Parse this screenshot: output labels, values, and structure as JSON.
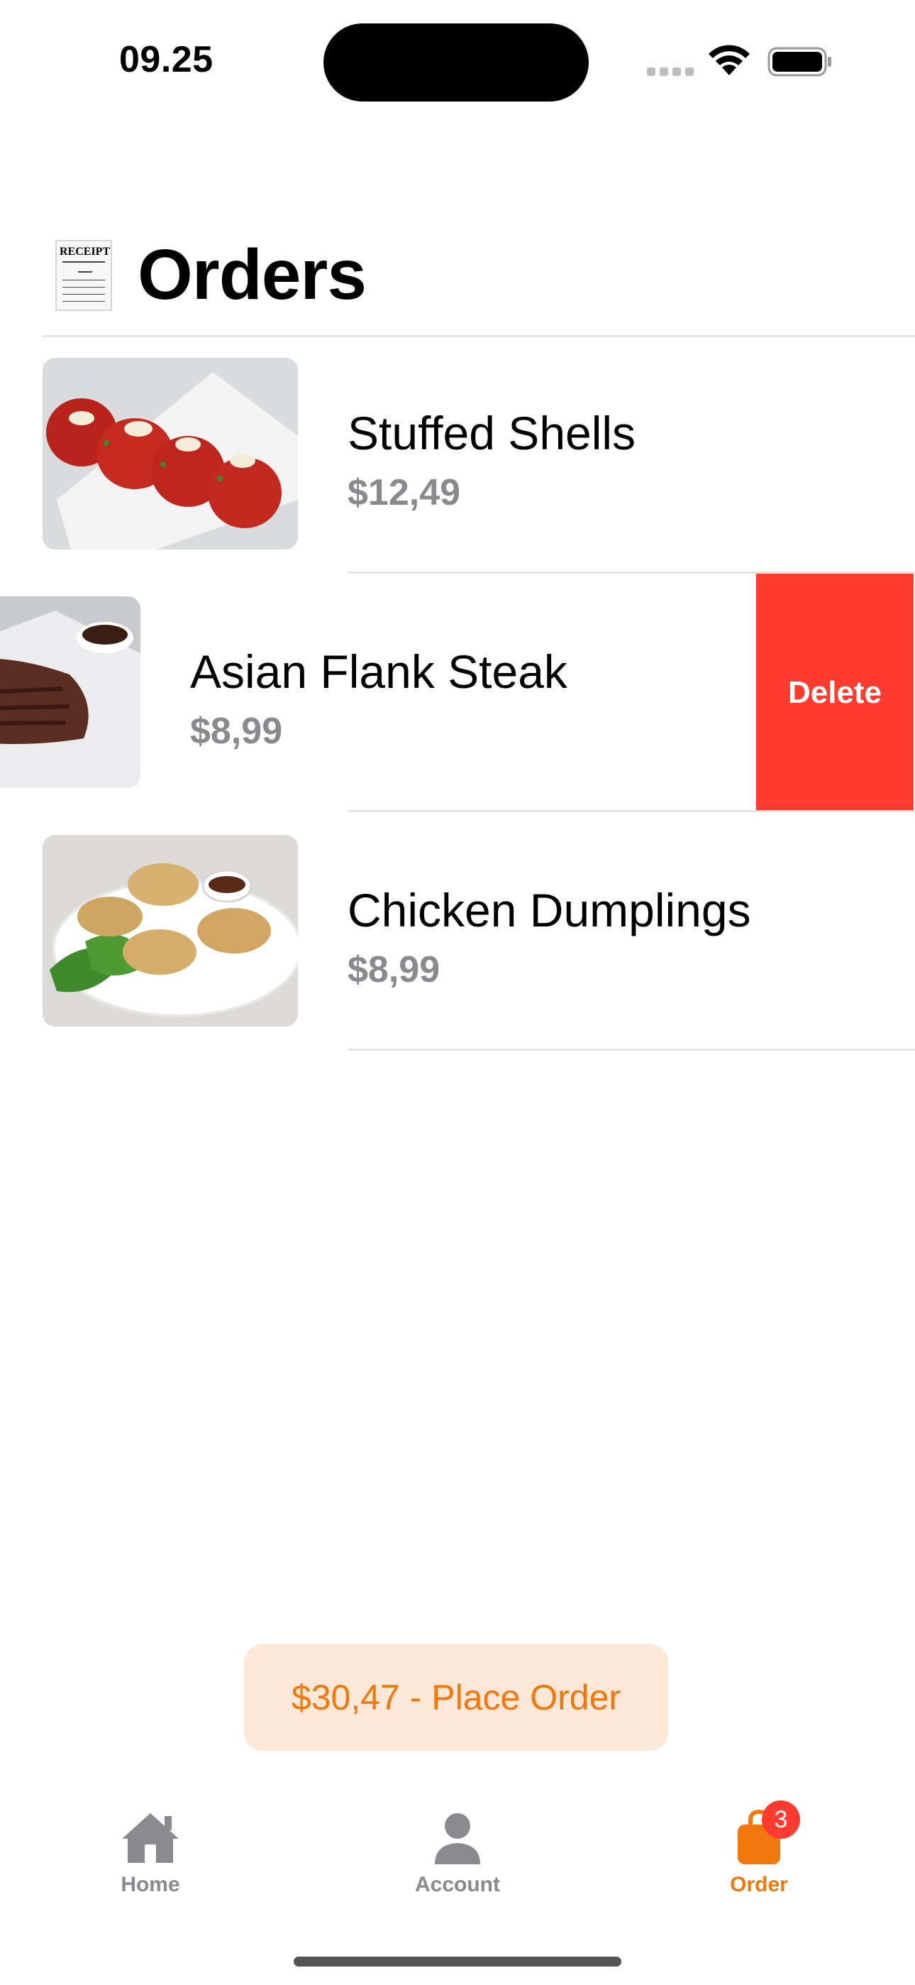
{
  "status_bar": {
    "time": "09.25"
  },
  "header": {
    "title": "Orders",
    "icon": "receipt-icon",
    "icon_text": "RECEIPT"
  },
  "orders": [
    {
      "name": "Stuffed Shells",
      "price": "$12,49",
      "image": "stuffed-shells-photo"
    },
    {
      "name": "Asian Flank Steak",
      "price": "$8,99",
      "image": "flank-steak-photo",
      "swiped": true,
      "delete_label": "Delete"
    },
    {
      "name": "Chicken Dumplings",
      "price": "$8,99",
      "image": "chicken-dumplings-photo"
    }
  ],
  "place_order": {
    "label": "$30,47 - Place Order"
  },
  "tab_bar": {
    "tabs": [
      {
        "label": "Home",
        "icon": "house-icon",
        "active": false
      },
      {
        "label": "Account",
        "icon": "person-icon",
        "active": false
      },
      {
        "label": "Order",
        "icon": "bag-icon",
        "active": true,
        "badge": "3"
      }
    ]
  },
  "colors": {
    "accent": "#f2780e",
    "accent_bg": "#fde7d6",
    "delete": "#ff3b30",
    "secondary_text": "#8a8a8e",
    "inactive_tab": "#8a8a8e"
  }
}
